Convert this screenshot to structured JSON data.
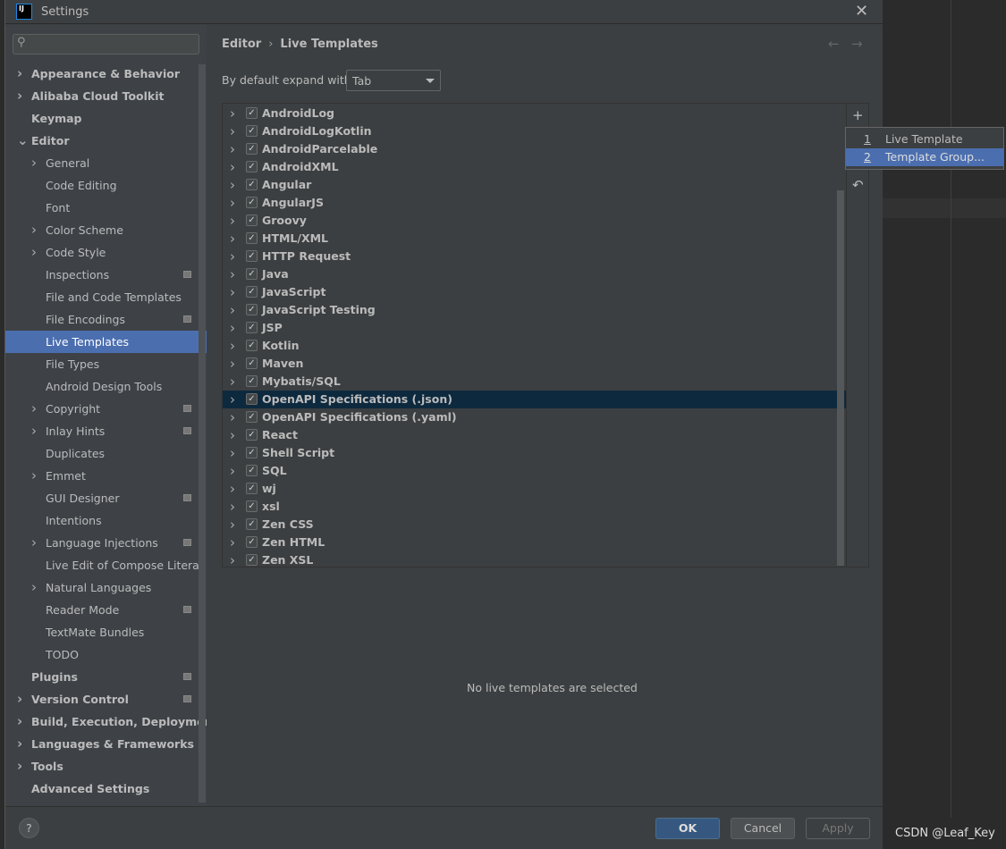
{
  "window": {
    "title": "Settings",
    "logo": "IJ"
  },
  "search": {
    "placeholder": "",
    "icon": "search-icon"
  },
  "sidebar": {
    "items": [
      {
        "label": "Appearance & Behavior",
        "level": 0,
        "expandable": true,
        "bold": true
      },
      {
        "label": "Alibaba Cloud Toolkit",
        "level": 0,
        "expandable": true,
        "bold": true
      },
      {
        "label": "Keymap",
        "level": 0,
        "expandable": false,
        "bold": true
      },
      {
        "label": "Editor",
        "level": 0,
        "expandable": true,
        "expanded": true,
        "bold": true
      },
      {
        "label": "General",
        "level": 1,
        "expandable": true
      },
      {
        "label": "Code Editing",
        "level": 1
      },
      {
        "label": "Font",
        "level": 1
      },
      {
        "label": "Color Scheme",
        "level": 1,
        "expandable": true
      },
      {
        "label": "Code Style",
        "level": 1,
        "expandable": true
      },
      {
        "label": "Inspections",
        "level": 1,
        "indicator": true
      },
      {
        "label": "File and Code Templates",
        "level": 1
      },
      {
        "label": "File Encodings",
        "level": 1,
        "indicator": true
      },
      {
        "label": "Live Templates",
        "level": 1,
        "selected": true
      },
      {
        "label": "File Types",
        "level": 1
      },
      {
        "label": "Android Design Tools",
        "level": 1
      },
      {
        "label": "Copyright",
        "level": 1,
        "expandable": true,
        "indicator": true
      },
      {
        "label": "Inlay Hints",
        "level": 1,
        "expandable": true,
        "indicator": true
      },
      {
        "label": "Duplicates",
        "level": 1
      },
      {
        "label": "Emmet",
        "level": 1,
        "expandable": true
      },
      {
        "label": "GUI Designer",
        "level": 1,
        "indicator": true
      },
      {
        "label": "Intentions",
        "level": 1
      },
      {
        "label": "Language Injections",
        "level": 1,
        "expandable": true,
        "indicator": true
      },
      {
        "label": "Live Edit of Compose Literal",
        "level": 1
      },
      {
        "label": "Natural Languages",
        "level": 1,
        "expandable": true
      },
      {
        "label": "Reader Mode",
        "level": 1,
        "indicator": true
      },
      {
        "label": "TextMate Bundles",
        "level": 1
      },
      {
        "label": "TODO",
        "level": 1
      },
      {
        "label": "Plugins",
        "level": 0,
        "bold": true,
        "indicator": true
      },
      {
        "label": "Version Control",
        "level": 0,
        "expandable": true,
        "bold": true,
        "indicator": true
      },
      {
        "label": "Build, Execution, Deployment",
        "level": 0,
        "expandable": true,
        "bold": true
      },
      {
        "label": "Languages & Frameworks",
        "level": 0,
        "expandable": true,
        "bold": true
      },
      {
        "label": "Tools",
        "level": 0,
        "expandable": true,
        "bold": true
      },
      {
        "label": "Advanced Settings",
        "level": 0,
        "bold": true
      }
    ]
  },
  "breadcrumb": {
    "parent": "Editor",
    "separator": "›",
    "current": "Live Templates"
  },
  "expand": {
    "label": "By default expand with",
    "value": "Tab"
  },
  "templates": [
    {
      "label": "AndroidLog",
      "checked": true
    },
    {
      "label": "AndroidLogKotlin",
      "checked": true
    },
    {
      "label": "AndroidParcelable",
      "checked": true
    },
    {
      "label": "AndroidXML",
      "checked": true
    },
    {
      "label": "Angular",
      "checked": true
    },
    {
      "label": "AngularJS",
      "checked": true
    },
    {
      "label": "Groovy",
      "checked": true
    },
    {
      "label": "HTML/XML",
      "checked": true
    },
    {
      "label": "HTTP Request",
      "checked": true
    },
    {
      "label": "Java",
      "checked": true
    },
    {
      "label": "JavaScript",
      "checked": true
    },
    {
      "label": "JavaScript Testing",
      "checked": true
    },
    {
      "label": "JSP",
      "checked": true
    },
    {
      "label": "Kotlin",
      "checked": true
    },
    {
      "label": "Maven",
      "checked": true
    },
    {
      "label": "Mybatis/SQL",
      "checked": true
    },
    {
      "label": "OpenAPI Specifications (.json)",
      "checked": true,
      "selected": true
    },
    {
      "label": "OpenAPI Specifications (.yaml)",
      "checked": true
    },
    {
      "label": "React",
      "checked": true
    },
    {
      "label": "Shell Script",
      "checked": true
    },
    {
      "label": "SQL",
      "checked": true
    },
    {
      "label": "wj",
      "checked": true
    },
    {
      "label": "xsl",
      "checked": true
    },
    {
      "label": "Zen CSS",
      "checked": true
    },
    {
      "label": "Zen HTML",
      "checked": true
    },
    {
      "label": "Zen XSL",
      "checked": true
    }
  ],
  "popup": {
    "items": [
      {
        "num": "1",
        "label": "Live Template"
      },
      {
        "num": "2",
        "label": "Template Group...",
        "selected": true
      }
    ]
  },
  "empty_message": "No live templates are selected",
  "footer": {
    "help": "?",
    "ok": "OK",
    "cancel": "Cancel",
    "apply": "Apply"
  },
  "watermark": "CSDN @Leaf_Key",
  "colors": {
    "selection": "#4b6eaf",
    "row_selection": "#0d293e",
    "ok_button": "#365880"
  }
}
